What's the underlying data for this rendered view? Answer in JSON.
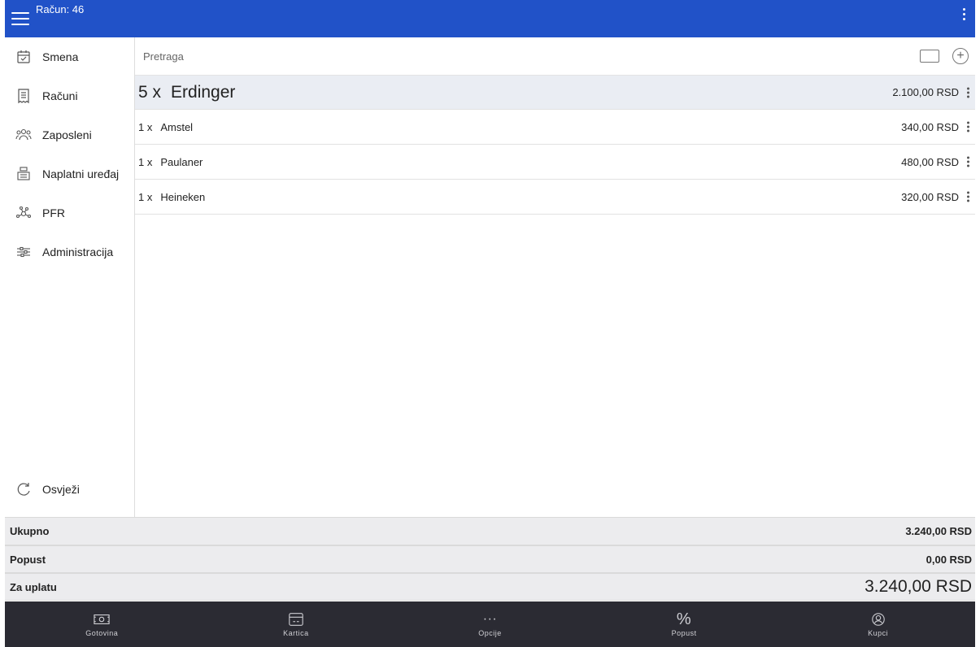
{
  "header": {
    "title": "Račun: 46"
  },
  "sidebar": {
    "items": [
      {
        "label": "Smena",
        "icon": "calendar-check-icon"
      },
      {
        "label": "Računi",
        "icon": "receipt-icon"
      },
      {
        "label": "Zaposleni",
        "icon": "people-icon"
      },
      {
        "label": "Naplatni uređaj",
        "icon": "cash-register-icon"
      },
      {
        "label": "PFR",
        "icon": "network-icon"
      },
      {
        "label": "Administracija",
        "icon": "sliders-icon"
      }
    ],
    "refresh_label": "Osvježi"
  },
  "search": {
    "placeholder": "Pretraga"
  },
  "items": [
    {
      "qty": "5 x",
      "name": "Erdinger",
      "price": "2.100,00 RSD"
    },
    {
      "qty": "1 x",
      "name": "Amstel",
      "price": "340,00 RSD"
    },
    {
      "qty": "1 x",
      "name": "Paulaner",
      "price": "480,00 RSD"
    },
    {
      "qty": "1 x",
      "name": "Heineken",
      "price": "320,00 RSD"
    }
  ],
  "totals": {
    "total_label": "Ukupno",
    "total_value": "3.240,00 RSD",
    "discount_label": "Popust",
    "discount_value": "0,00 RSD",
    "payable_label": "Za uplatu",
    "payable_value": "3.240,00 RSD"
  },
  "bottom": {
    "cash": "Gotovina",
    "card": "Kartica",
    "options": "Opcije",
    "discount": "Popust",
    "customers": "Kupci"
  },
  "colors": {
    "header": "#2152c8",
    "bottom_bar": "#2b2b33",
    "highlight_row": "#eaedf3"
  }
}
